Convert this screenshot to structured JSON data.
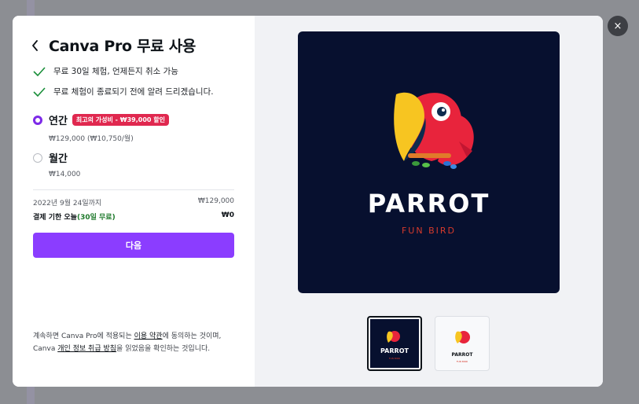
{
  "modal": {
    "title": "Canva Pro 무료 사용",
    "features": [
      "무료 30일 체험, 언제든지 취소 가능",
      "무료 체험이 종료되기 전에 알려 드리겠습니다."
    ],
    "plans": [
      {
        "name": "연간",
        "badge": "최고의 가성비 - ₩39,000 할인",
        "price": "₩129,000 (₩10,750/월)",
        "selected": true
      },
      {
        "name": "월간",
        "price": "₩14,000",
        "selected": false
      }
    ],
    "summary": {
      "until_label": "2022년 9월 24일까지",
      "until_value": "₩129,000",
      "due_label": "결제 기한 오늘",
      "due_free": "(30일 무료)",
      "due_value": "₩0"
    },
    "next_label": "다음",
    "legal": {
      "part1": "계속하면 Canva Pro에 적용되는 ",
      "link1": "이용 약관",
      "part2": "에 동의하는 것이며, Canva ",
      "link2": "개인 정보 취급 방침",
      "part3": "을 읽었음을 확인하는 것입니다."
    },
    "close_icon": "×"
  },
  "preview": {
    "logo_title": "PARROT",
    "logo_subtitle": "FUN BIRD",
    "thumbnails": [
      "dark",
      "light"
    ],
    "colors": {
      "dark_bg": "#07102f",
      "title": "#ffffff",
      "subtitle": "#d63a2c",
      "accent": "#8b3dff"
    }
  }
}
